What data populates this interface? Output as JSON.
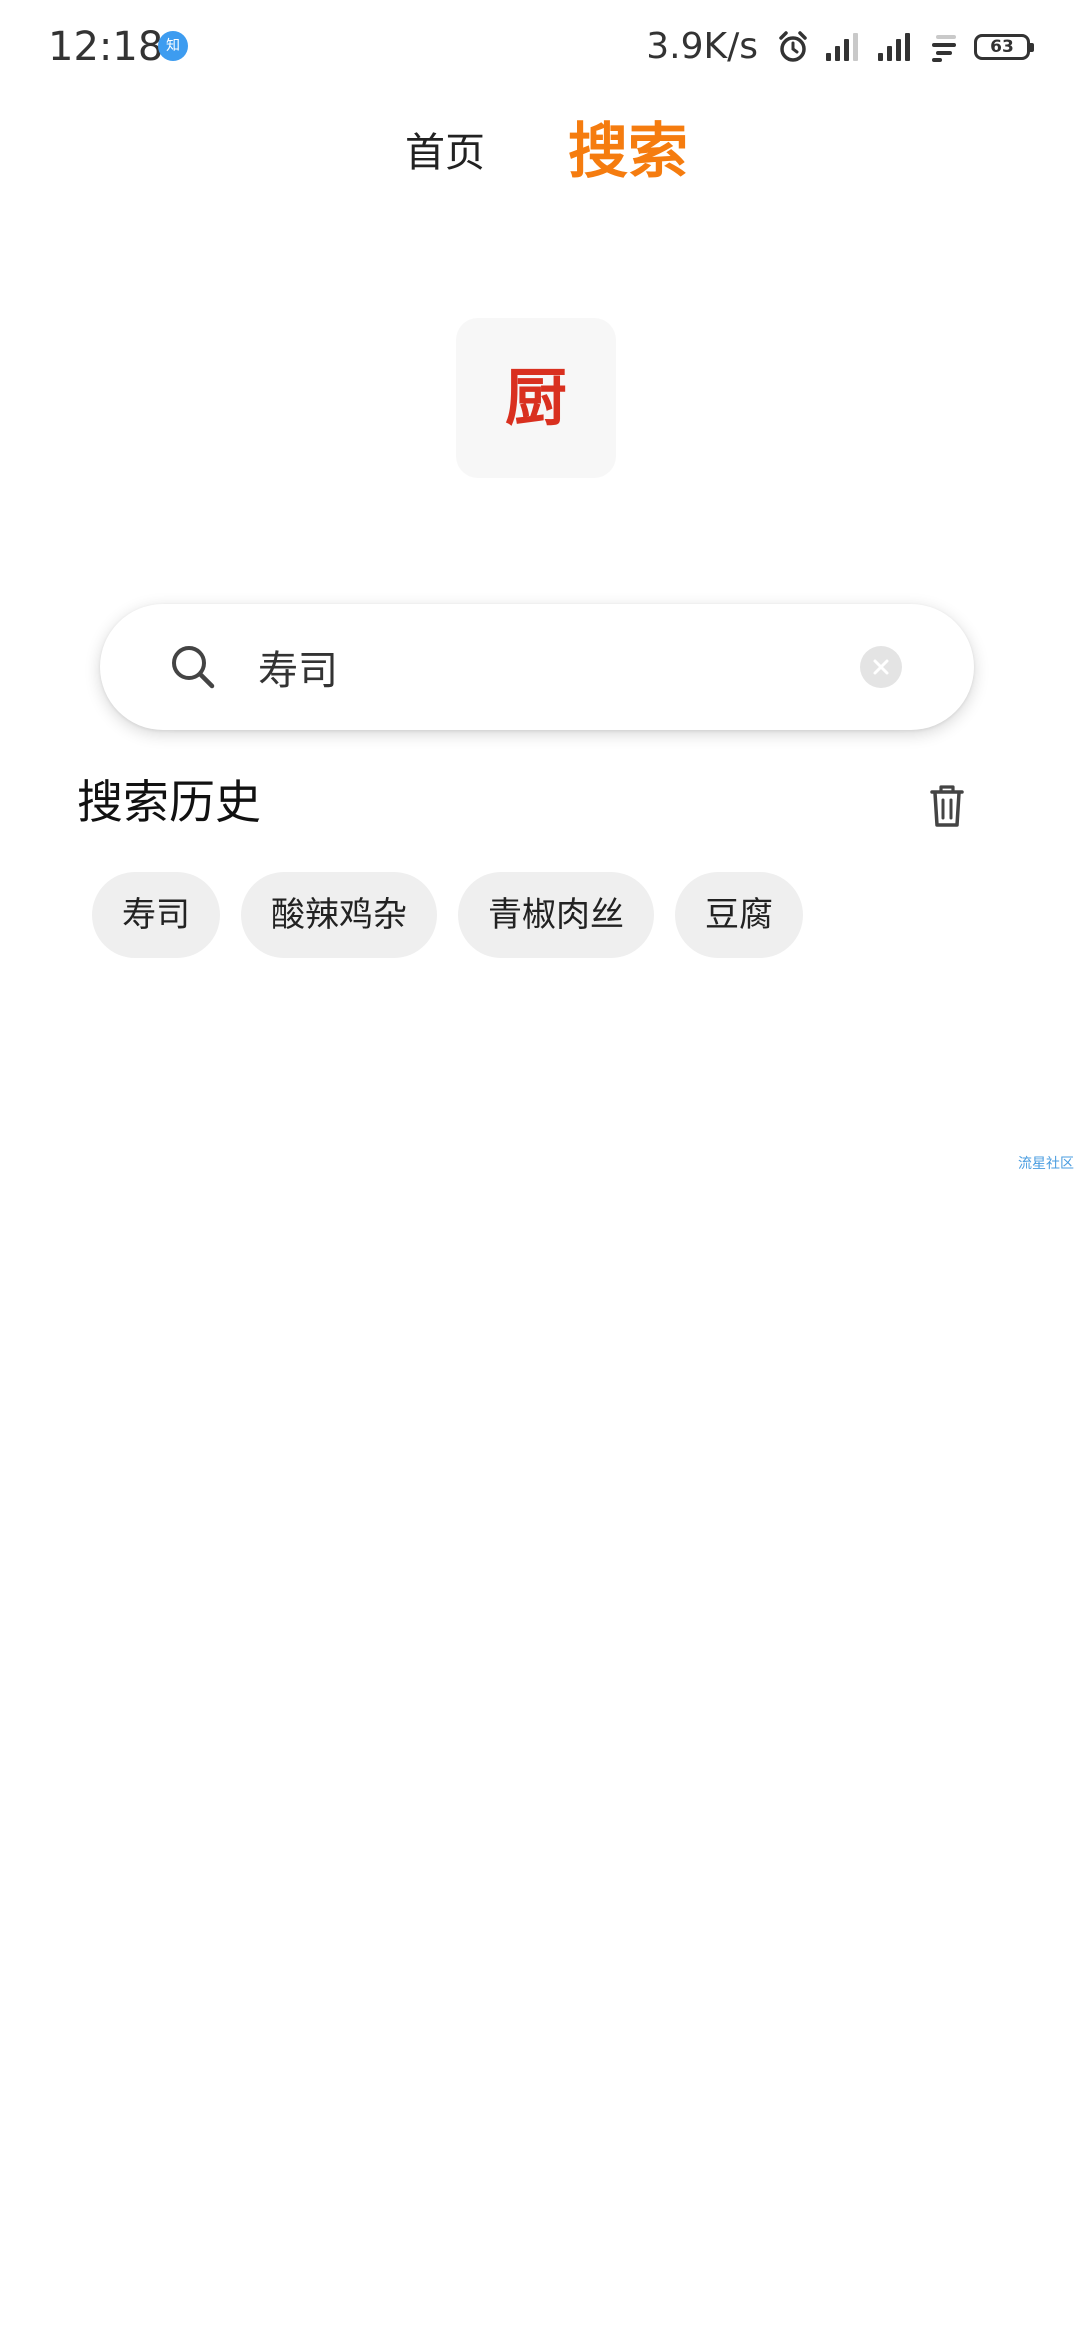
{
  "status_bar": {
    "time": "12:18",
    "notification_badge": "知",
    "network_speed": "3.9K/s",
    "battery_level": "63",
    "icons": [
      "alarm-icon",
      "signal-icon",
      "signal-icon",
      "wifi-icon",
      "battery-icon"
    ]
  },
  "nav": {
    "tabs": [
      {
        "label": "首页",
        "active": false
      },
      {
        "label": "搜索",
        "active": true
      }
    ]
  },
  "logo": {
    "char": "厨"
  },
  "search": {
    "value": "寿司",
    "placeholder": ""
  },
  "history": {
    "title": "搜索历史",
    "items": [
      {
        "label": "寿司"
      },
      {
        "label": "酸辣鸡杂"
      },
      {
        "label": "青椒肉丝"
      },
      {
        "label": "豆腐"
      }
    ]
  },
  "watermark": {
    "text": "流星社区"
  },
  "colors": {
    "accent": "#f57c0f",
    "logo": "#d9301f",
    "chip_bg": "#efefef",
    "badge": "#3d9cf0"
  }
}
